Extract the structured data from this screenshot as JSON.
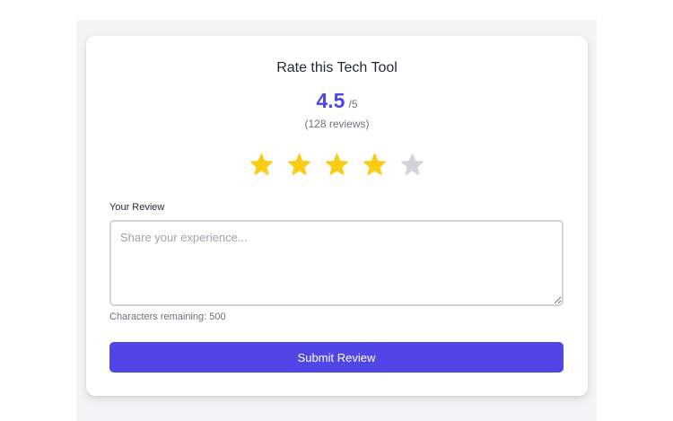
{
  "title": "Rate this Tech Tool",
  "rating": {
    "score": "4.5",
    "max": "/5",
    "count": "(128 reviews)",
    "stars_filled": 4,
    "stars_total": 5,
    "filled_color": "#facc15",
    "empty_color": "#d1d5db"
  },
  "review": {
    "label": "Your Review",
    "placeholder": "Share your experience...",
    "value": "",
    "chars_remaining": "Characters remaining: 500"
  },
  "submit": {
    "label": "Submit Review",
    "color": "#4f46e5"
  }
}
